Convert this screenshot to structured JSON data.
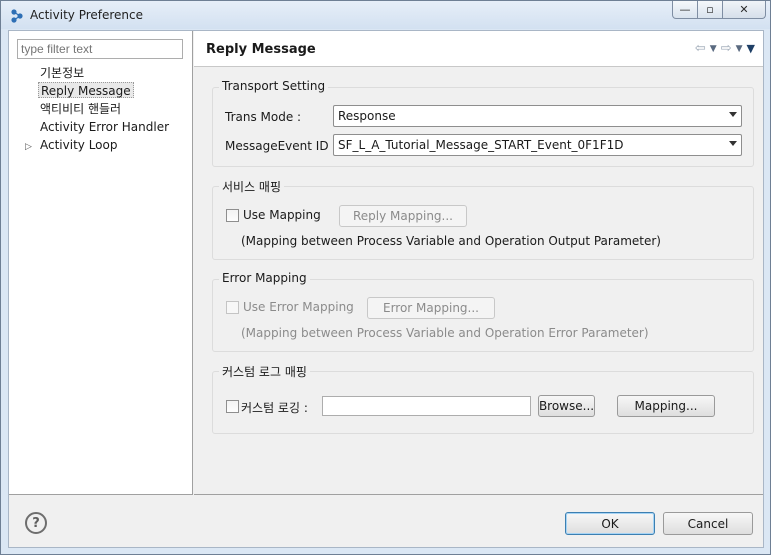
{
  "window": {
    "title": "Activity Preference",
    "controls": {
      "minimize": "—",
      "maximize": "▫",
      "close": "✕"
    }
  },
  "left_pane": {
    "filter_placeholder": "type filter text",
    "items": [
      {
        "label": "기본정보"
      },
      {
        "label": "Reply Message",
        "selected": true
      },
      {
        "label": "액티비티 핸들러"
      },
      {
        "label": "Activity Error Handler"
      },
      {
        "label": "Activity Loop",
        "expandable": true
      }
    ],
    "expand_glyph": "▷"
  },
  "page": {
    "title": "Reply Message",
    "nav": {
      "back": "⇦",
      "forward": "⇨",
      "drop": "▼",
      "menu": "▼"
    }
  },
  "transport": {
    "title": "Transport Setting",
    "trans_mode_label": "Trans Mode :",
    "trans_mode_value": "Response",
    "message_event_label": "MessageEvent ID :",
    "message_event_value": "SF_L_A_Tutorial_Message_START_Event_0F1F1D"
  },
  "service_mapping": {
    "title": "서비스 매핑",
    "use_mapping_label": "Use Mapping",
    "use_mapping_checked": false,
    "button_label": "Reply Mapping...",
    "description": "(Mapping between Process Variable and Operation Output Parameter)"
  },
  "error_mapping": {
    "title": "Error Mapping",
    "use_label": "Use Error Mapping",
    "use_checked": false,
    "button_label": "Error Mapping...",
    "description": "(Mapping between Process Variable and Operation Error Parameter)"
  },
  "custom_log": {
    "title": "커스텀 로그 매핑",
    "checkbox_label": "커스텀 로깅 :",
    "checked": false,
    "field_value": "",
    "browse_label": "Browse...",
    "mapping_label": "Mapping..."
  },
  "footer": {
    "help_glyph": "?",
    "ok_label": "OK",
    "cancel_label": "Cancel"
  }
}
